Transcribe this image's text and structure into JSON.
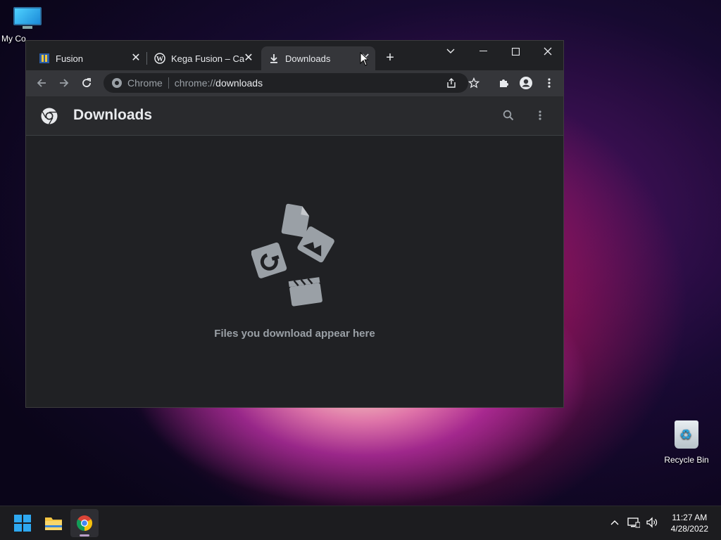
{
  "desktop": {
    "icons": [
      {
        "label": "My Co"
      },
      {
        "label": "Recycle Bin"
      }
    ]
  },
  "browser": {
    "tabs": [
      {
        "title": "Fusion",
        "favicon": "fusion-icon",
        "active": false
      },
      {
        "title": "Kega Fusion – Car",
        "favicon": "wordpress-icon",
        "active": false
      },
      {
        "title": "Downloads",
        "favicon": "download-icon",
        "active": true
      }
    ],
    "omnibox": {
      "chip": "Chrome",
      "url_scheme": "chrome://",
      "url_host": "downloads"
    },
    "page": {
      "title": "Downloads",
      "empty_message": "Files you download appear here"
    }
  },
  "taskbar": {
    "clock": {
      "time": "11:27 AM",
      "date": "4/28/2022"
    }
  },
  "colors": {
    "window_bg": "#202124",
    "toolbar_bg": "#35363a",
    "header_bg": "#292a2d",
    "text": "#e8eaed",
    "muted": "#9aa0a6"
  }
}
